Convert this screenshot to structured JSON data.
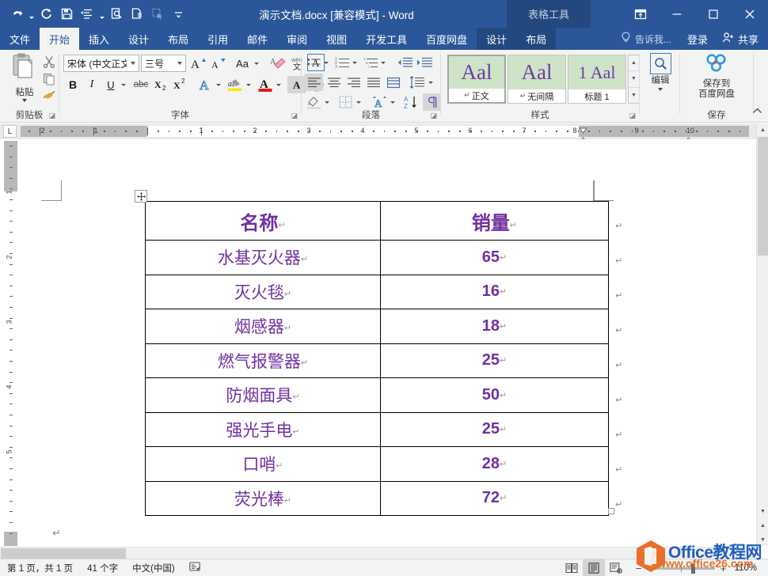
{
  "window": {
    "title": "演示文档.docx [兼容模式] - Word",
    "contextual_tool": "表格工具",
    "quick_access": [
      {
        "name": "undo-icon",
        "label": "撤消"
      },
      {
        "name": "redo-icon",
        "label": "重复"
      },
      {
        "name": "save-icon",
        "label": "保存"
      },
      {
        "name": "format-icon",
        "label": "格式"
      },
      {
        "name": "print-preview-icon",
        "label": "打印预览"
      },
      {
        "name": "new-doc-icon",
        "label": "新建"
      },
      {
        "name": "select-icon",
        "label": "选择"
      },
      {
        "name": "customize-qat-icon",
        "label": "自定义快速访问工具栏"
      }
    ],
    "controls": {
      "ribbon_display": "功能区显示选项",
      "minimize": "最小化",
      "maximize": "最大化",
      "close": "关闭"
    }
  },
  "tabs": {
    "main": [
      {
        "label": "文件",
        "active": false
      },
      {
        "label": "开始",
        "active": true
      },
      {
        "label": "插入",
        "active": false
      },
      {
        "label": "设计",
        "active": false
      },
      {
        "label": "布局",
        "active": false
      },
      {
        "label": "引用",
        "active": false
      },
      {
        "label": "邮件",
        "active": false
      },
      {
        "label": "审阅",
        "active": false
      },
      {
        "label": "视图",
        "active": false
      },
      {
        "label": "开发工具",
        "active": false
      },
      {
        "label": "百度网盘",
        "active": false
      }
    ],
    "contextual": [
      {
        "label": "设计"
      },
      {
        "label": "布局"
      }
    ],
    "tell_me": "告诉我...",
    "sign_in": "登录",
    "share": "共享"
  },
  "ribbon": {
    "groups": [
      {
        "name": "clipboard",
        "label": "剪贴板"
      },
      {
        "name": "font",
        "label": "字体"
      },
      {
        "name": "paragraph",
        "label": "段落"
      },
      {
        "name": "styles",
        "label": "样式"
      },
      {
        "name": "save",
        "label": "保存"
      }
    ],
    "clipboard": {
      "paste_label": "粘贴",
      "cut_label": "剪切",
      "copy_label": "复制",
      "format_painter_label": "格式刷"
    },
    "font": {
      "font_name": "宋体 (中文正文",
      "font_size": "三号",
      "grow_font": "A",
      "shrink_font": "A",
      "change_case": "Aa",
      "clear_format_label": "清除所有格式",
      "phonetic_label": "拼音指南",
      "char_border_label": "字符边框",
      "bold": "B",
      "italic": "I",
      "underline": "U",
      "strikethrough": "abc",
      "subscript": "X₂",
      "superscript": "X²",
      "text_effects": "A",
      "highlight": "ab",
      "font_color": "A",
      "char_shading": "A",
      "enclose_char": "字"
    },
    "paragraph": {
      "bullets": "项目符号",
      "numbering": "编号",
      "multilevel": "多级列表",
      "decrease_indent": "减少缩进",
      "increase_indent": "增加缩进",
      "align_left": "左对齐",
      "align_center": "居中",
      "align_right": "右对齐",
      "justify": "两端对齐",
      "distribute": "分散对齐",
      "line_spacing": "行和段落间距",
      "shading": "底纹",
      "borders": "边框",
      "asian_layout": "中文版式",
      "sort": "排序",
      "show_marks": "显示编辑标记"
    },
    "styles": {
      "items": [
        {
          "preview": "Aal",
          "name": "正文",
          "selected": true,
          "mark": "↵"
        },
        {
          "preview": "Aal",
          "name": "无间隔",
          "selected": false,
          "mark": "↵"
        },
        {
          "preview": "1 Aal",
          "name": "标题 1",
          "selected": false,
          "mark": ""
        }
      ]
    },
    "edit": {
      "label": "编辑"
    },
    "baidu": {
      "label_line1": "保存到",
      "label_line2": "百度网盘"
    }
  },
  "ruler": {
    "tab_stop_marker": "L",
    "horizontal_left_numbers": [
      "2",
      "1"
    ],
    "horizontal_numbers": [
      "1",
      "2",
      "3",
      "4",
      "5",
      "6",
      "7",
      "8"
    ],
    "horizontal_right_numbers": [
      "9",
      "10"
    ],
    "vertical_numbers": [
      "1",
      "2",
      "3",
      "4",
      "5"
    ]
  },
  "document": {
    "table": {
      "headers": [
        "名称",
        "销量"
      ],
      "rows": [
        {
          "name": "水基灭火器",
          "qty": "65"
        },
        {
          "name": "灭火毯",
          "qty": "16"
        },
        {
          "name": "烟感器",
          "qty": "18"
        },
        {
          "name": "燃气报警器",
          "qty": "25"
        },
        {
          "name": "防烟面具",
          "qty": "50"
        },
        {
          "name": "强光手电",
          "qty": "25"
        },
        {
          "name": "口哨",
          "qty": "28"
        },
        {
          "name": "荧光棒",
          "qty": "72"
        }
      ],
      "paragraph_mark": "↵",
      "text_color": "#7030a0"
    }
  },
  "status": {
    "page_info": "第 1 页，共 1 页",
    "word_count": "41 个字",
    "language": "中文(中国)",
    "proofing_icon": "proofing-icon",
    "views": [
      {
        "name": "read-mode-icon",
        "label": "阅读视图",
        "active": false
      },
      {
        "name": "print-layout-icon",
        "label": "页面视图",
        "active": true
      },
      {
        "name": "web-layout-icon",
        "label": "Web 版式视图",
        "active": false
      }
    ],
    "zoom_out": "−",
    "zoom_in": "+",
    "zoom_level": "110%"
  },
  "watermark": {
    "line1_en": "Office",
    "line1_cn": "教程网",
    "line2": "www.office26.com"
  }
}
